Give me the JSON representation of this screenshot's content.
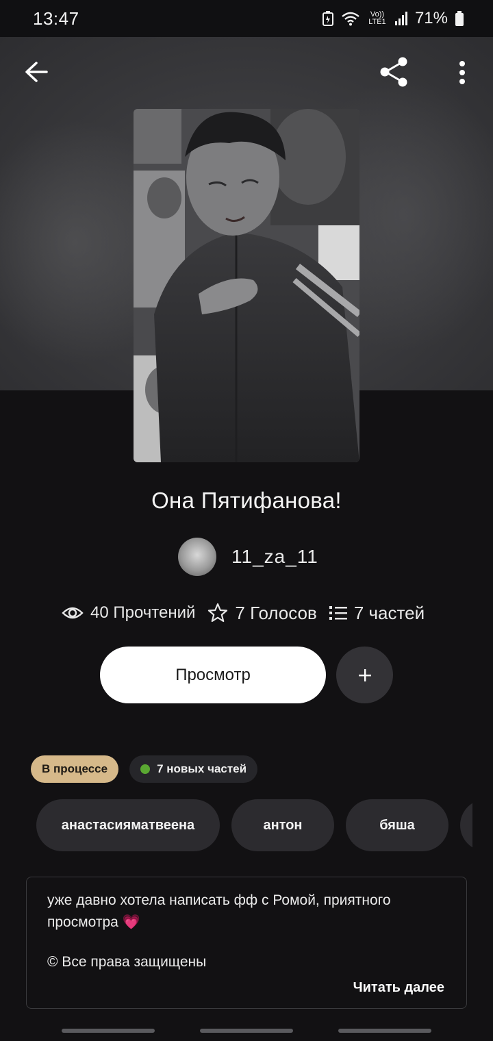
{
  "status_bar": {
    "time": "13:47",
    "network_label": "Vo)) LTE1",
    "battery_percent": "71%"
  },
  "header": {
    "back_icon": "arrow-left-icon",
    "share_icon": "share-icon",
    "more_icon": "more-vertical-icon"
  },
  "story": {
    "title": "Она Пятифанова!",
    "author": "11_za_11",
    "stats": {
      "reads": "40 Прочтений",
      "votes": "7 Голосов",
      "parts": "7 частей"
    },
    "read_button": "Просмотр",
    "add_button": "+",
    "status_badge": "В процессе",
    "new_parts_badge": "7 новых частей",
    "tags": [
      "анастасияматвеена",
      "антон",
      "бяша",
      ""
    ],
    "description": "уже давно хотела написать фф с Ромой, приятного просмотра 💗",
    "copyright": "© Все права защищены",
    "read_more": "Читать далее"
  },
  "colors": {
    "background": "#121113",
    "status_badge": "#d6b98a",
    "new_dot": "#5aa832",
    "tag_bg": "#2c2b2f",
    "button_primary": "#ffffff"
  }
}
